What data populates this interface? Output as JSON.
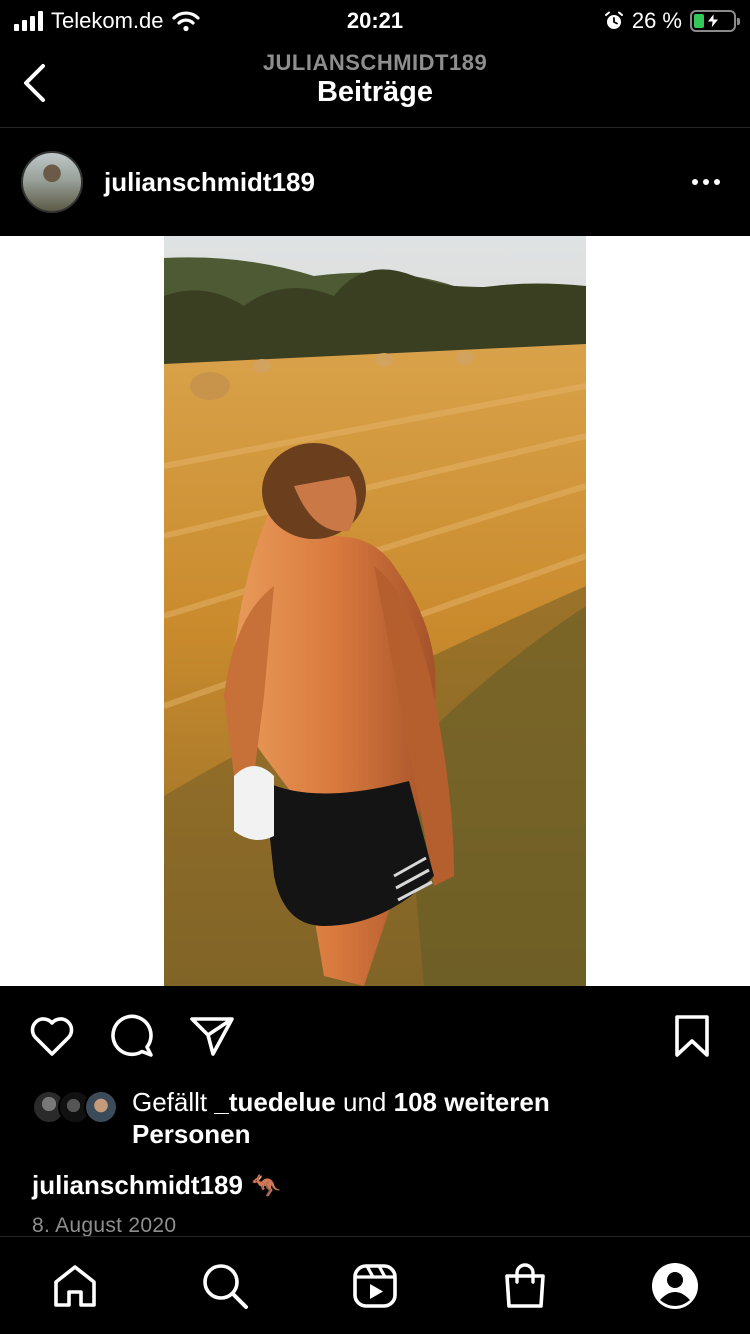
{
  "status_bar": {
    "carrier": "Telekom.de",
    "time": "20:21",
    "battery_percent": "26 %",
    "battery_level": 0.26,
    "colors": {
      "battery": "#34c759"
    }
  },
  "header": {
    "subtitle": "JULIANSCHMIDT189",
    "title": "Beiträge"
  },
  "post": {
    "username": "julianschmidt189",
    "likes": {
      "prefix": "Gefällt",
      "user": "_tuedelue",
      "connector": "und",
      "count": "108 weiteren",
      "suffix": "Personen"
    },
    "caption_user": "julianschmidt189",
    "caption_emoji": "🦘",
    "date": "8. August 2020"
  },
  "icons": {
    "back": "chevron-left-icon",
    "more": "more-options-icon",
    "like": "heart-icon",
    "comment": "comment-icon",
    "share": "send-icon",
    "save": "bookmark-icon",
    "tabs": [
      "home-icon",
      "search-icon",
      "reels-icon",
      "shop-icon",
      "profile-icon"
    ]
  }
}
